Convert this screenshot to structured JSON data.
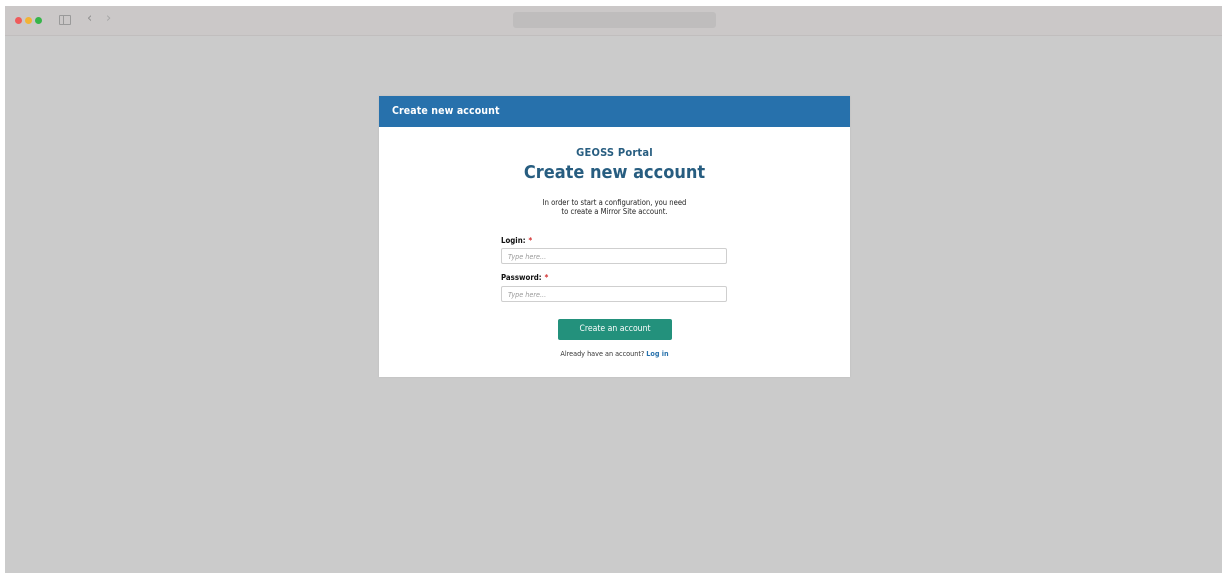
{
  "browser": {
    "back_glyph": "‹",
    "forward_glyph": "›"
  },
  "modal": {
    "header_title": "Create new account",
    "brand": {
      "mark": "GEOSS",
      "name": "Portal"
    },
    "heading": "Create new account",
    "intro_line1": "In order to start a configuration, you need",
    "intro_line2": "to create a Mirror Site account.",
    "login": {
      "label": "Login:",
      "required_marker": "*",
      "value": "",
      "placeholder": "Type here..."
    },
    "password": {
      "label": "Password:",
      "required_marker": "*",
      "value": "",
      "placeholder": "Type here..."
    },
    "submit_label": "Create an account",
    "already_text": "Already have an account?",
    "login_link": "Log in"
  },
  "colors": {
    "header_blue": "#2771ac",
    "heading_navy": "#275d80",
    "button_teal": "#23917c",
    "required_red": "#d32f2f",
    "backdrop_gray": "#cbcbcb"
  },
  "icons": {
    "window_close": "red-dot-icon",
    "window_minimize": "yellow-dot-icon",
    "window_zoom": "green-dot-icon",
    "sidebar": "sidebar-toggle-icon",
    "back": "chevron-left-icon",
    "forward": "chevron-right-icon"
  }
}
